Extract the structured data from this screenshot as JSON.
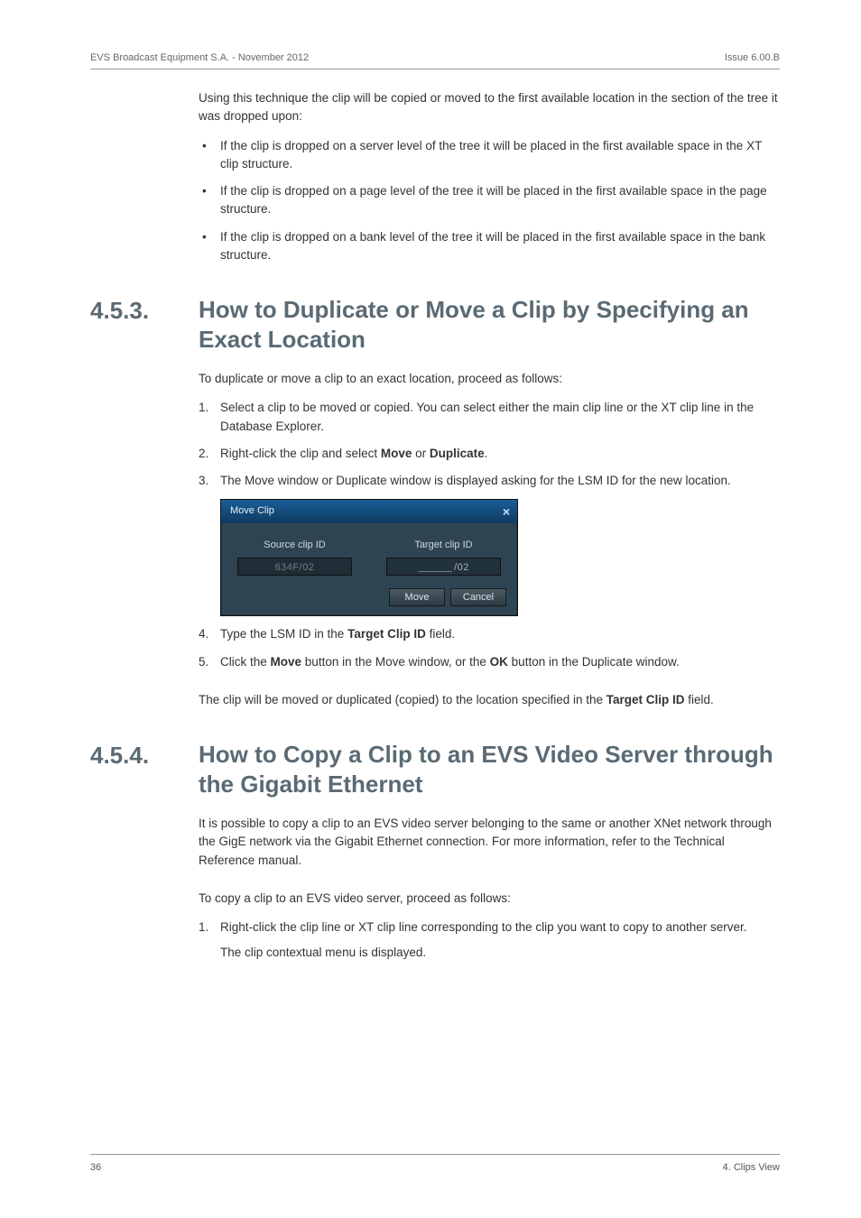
{
  "header": {
    "left": "EVS Broadcast Equipment S.A.  - November 2012",
    "right": "Issue 6.00.B"
  },
  "intro": {
    "lead": "Using this technique the clip will be copied or moved to the first available location in the section of the tree it was dropped upon:",
    "bullets": [
      "If the clip is dropped on a server level of the tree it will be placed in the first available space in the XT clip structure.",
      "If the clip is dropped on a page level of the tree it will be placed in the first available space in the page structure.",
      "If the clip is dropped on a bank level of the tree it will be placed in the first available space in the bank structure."
    ]
  },
  "sec453": {
    "num": "4.5.3.",
    "title": "How to Duplicate or Move a Clip by Specifying an Exact Location",
    "lead": "To duplicate or move a clip to an exact location, proceed as follows:",
    "step1": "Select a clip to be moved or copied. You can select either the main clip line or the XT clip line in the Database Explorer.",
    "step2_pre": "Right-click the clip and select ",
    "step2_b1": "Move",
    "step2_mid": " or ",
    "step2_b2": "Duplicate",
    "step2_post": ".",
    "step3": "The Move window or Duplicate window is displayed asking for the LSM ID for the new location.",
    "step4_pre": "Type the LSM ID in the ",
    "step4_b": "Target Clip ID",
    "step4_post": " field.",
    "step5_pre": "Click the ",
    "step5_b1": "Move",
    "step5_mid": " button in the Move window, or the ",
    "step5_b2": "OK",
    "step5_post": " button in the Duplicate window.",
    "tail_pre": "The clip will be moved or duplicated (copied) to the location specified in the ",
    "tail_b": "Target Clip ID",
    "tail_post": " field."
  },
  "dialog": {
    "title": "Move Clip",
    "src_lbl": "Source clip ID",
    "src_val": "634F/02",
    "tgt_lbl": "Target clip ID",
    "tgt_val": "/02",
    "move": "Move",
    "cancel": "Cancel"
  },
  "sec454": {
    "num": "4.5.4.",
    "title": "How to Copy a Clip to an EVS Video Server through the Gigabit Ethernet",
    "p1": "It is possible to copy a clip to an EVS video server belonging to the same or another XNet network through the GigE network via the Gigabit Ethernet connection. For more information, refer to the Technical Reference manual.",
    "p2": "To copy a clip to an EVS video server, proceed as follows:",
    "step1": "Right-click the clip line or XT clip line corresponding to the clip you want to copy to another server.",
    "step1_sub": "The clip contextual menu is displayed."
  },
  "footer": {
    "left": "36",
    "right": "4. Clips View"
  }
}
